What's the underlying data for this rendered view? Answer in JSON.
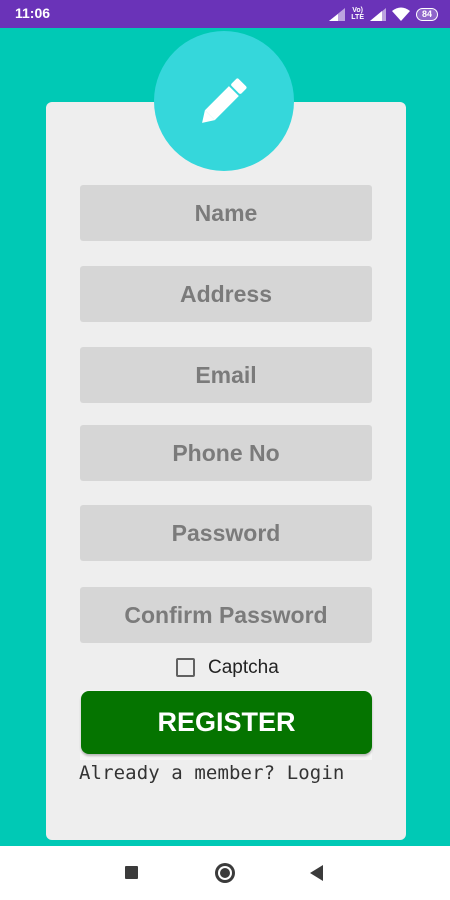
{
  "status_bar": {
    "time": "11:06",
    "volte_top": "Vo)",
    "volte_bottom": "LTE",
    "battery": "84",
    "icons": [
      "signal-icon",
      "volte-icon",
      "signal-icon",
      "wifi-icon",
      "battery-icon"
    ]
  },
  "colors": {
    "background": "#00C9B5",
    "status_bar": "#6A33B8",
    "card": "#EEEEEE",
    "avatar": "#35D7DB",
    "field": "#D6D6D6",
    "field_text": "#7B7B7B",
    "register_button": "#057400"
  },
  "form": {
    "header_icon": "pencil-icon",
    "fields": [
      {
        "placeholder": "Name"
      },
      {
        "placeholder": "Address"
      },
      {
        "placeholder": "Email"
      },
      {
        "placeholder": "Phone No"
      },
      {
        "placeholder": "Password"
      },
      {
        "placeholder": "Confirm Password"
      }
    ],
    "captcha_label": "Captcha",
    "captcha_checked": false,
    "register_label": "REGISTER",
    "login_prompt": "Already a member? Login"
  },
  "nav_bar": {
    "icons": [
      "recents-square-icon",
      "home-circle-icon",
      "back-triangle-icon"
    ]
  }
}
